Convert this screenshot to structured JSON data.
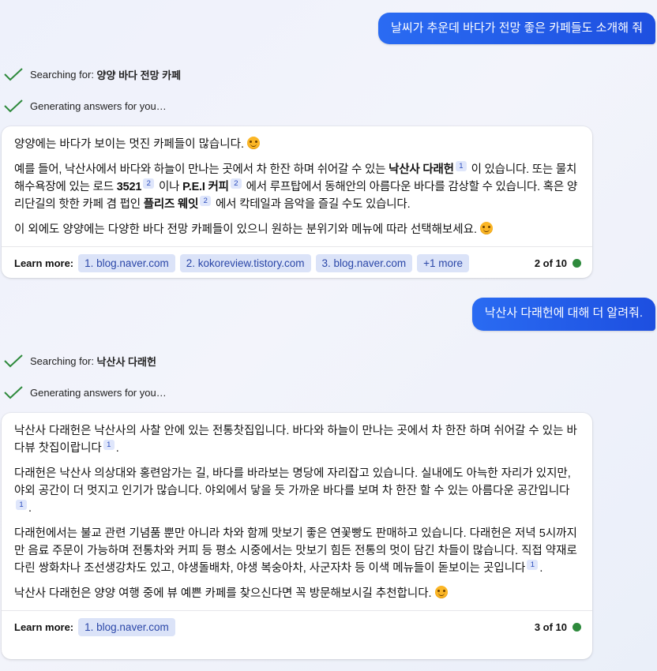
{
  "colors": {
    "user_bubble": "#2563eb",
    "check": "#2e8a3c",
    "chip_bg": "#dbe3f8",
    "dot": "#2e8a3c"
  },
  "conversation": [
    {
      "user_message": "날씨가 추운데 바다가 전망 좋은 카페들도 소개해 줘",
      "status": {
        "searching_prefix": "Searching for: ",
        "searching_query": "양양 바다 전망 카페",
        "generating": "Generating answers for you…"
      },
      "answer": {
        "p1": "양양에는 바다가 보이는 멋진 카페들이 많습니다.",
        "p2_a": "예를 들어, 낙산사에서 바다와 하늘이 만나는 곳에서 차 한잔 하며 쉬어갈 수 있는 ",
        "p2_b": "낙산사 다래헌",
        "p2_c1": "1",
        "p2_d": " 이 있습니다. 또는 물치 해수욕장에 있는 로드 ",
        "p2_e": "3521",
        "p2_c2": "2",
        "p2_f": " 이나 ",
        "p2_g": "P.E.I 커피",
        "p2_c3": "2",
        "p2_h": " 에서 루프탑에서 동해안의 아름다운 바다를 감상할 수 있습니다. 혹은 양리단길의 핫한 카페 겸 펍인 ",
        "p2_i": "플리즈 웨잇",
        "p2_c4": "2",
        "p2_j": " 에서 칵테일과 음악을 즐길 수도 있습니다.",
        "p3": "이 외에도 양양에는 다양한 바다 전망 카페들이 있으니 원하는 분위기와 메뉴에 따라 선택해보세요.",
        "learn_more": "Learn more:",
        "sources": [
          "1. blog.naver.com",
          "2. kokoreview.tistory.com",
          "3. blog.naver.com",
          "+1 more"
        ],
        "counter": "2 of 10"
      }
    },
    {
      "user_message": "낙산사 다래헌에 대해 더 알려줘.",
      "status": {
        "searching_prefix": "Searching for: ",
        "searching_query": "낙산사 다래헌",
        "generating": "Generating answers for you…"
      },
      "answer": {
        "p1": "낙산사 다래헌은 낙산사의 사찰 안에 있는 전통찻집입니다. 바다와 하늘이 만나는 곳에서 차 한잔 하며 쉬어갈 수 있는 바다뷰 찻집이랍니다",
        "p1_c": "1",
        "p2": "다래헌은 낙산사 의상대와 홍련암가는 길, 바다를 바라보는 명당에 자리잡고 있습니다. 실내에도 아늑한 자리가 있지만, 야외 공간이 더 멋지고 인기가 많습니다. 야외에서 닿을 듯 가까운 바다를 보며 차 한잔 할 수 있는 아름다운 공간입니다",
        "p2_c": "1",
        "p3": "다래헌에서는 불교 관련 기념품 뿐만 아니라 차와 함께 맛보기 좋은 연꽃빵도 판매하고 있습니다. 다래헌은 저녁 5시까지만 음료 주문이 가능하며 전통차와 커피 등 평소 시중에서는 맛보기 힘든 전통의 멋이 담긴 차들이 많습니다. 직접 약재로 다린 쌍화차나 조선생강차도 있고, 야생돌배차, 야생 복숭아차, 사군자차 등 이색 메뉴들이 돋보이는 곳입니다",
        "p3_c": "1",
        "p4": "낙산사 다래헌은 양양 여행 중에 뷰 예쁜 카페를 찾으신다면 꼭 방문해보시길 추천합니다.",
        "learn_more": "Learn more:",
        "sources": [
          "1. blog.naver.com"
        ],
        "counter": "3 of 10"
      }
    }
  ]
}
